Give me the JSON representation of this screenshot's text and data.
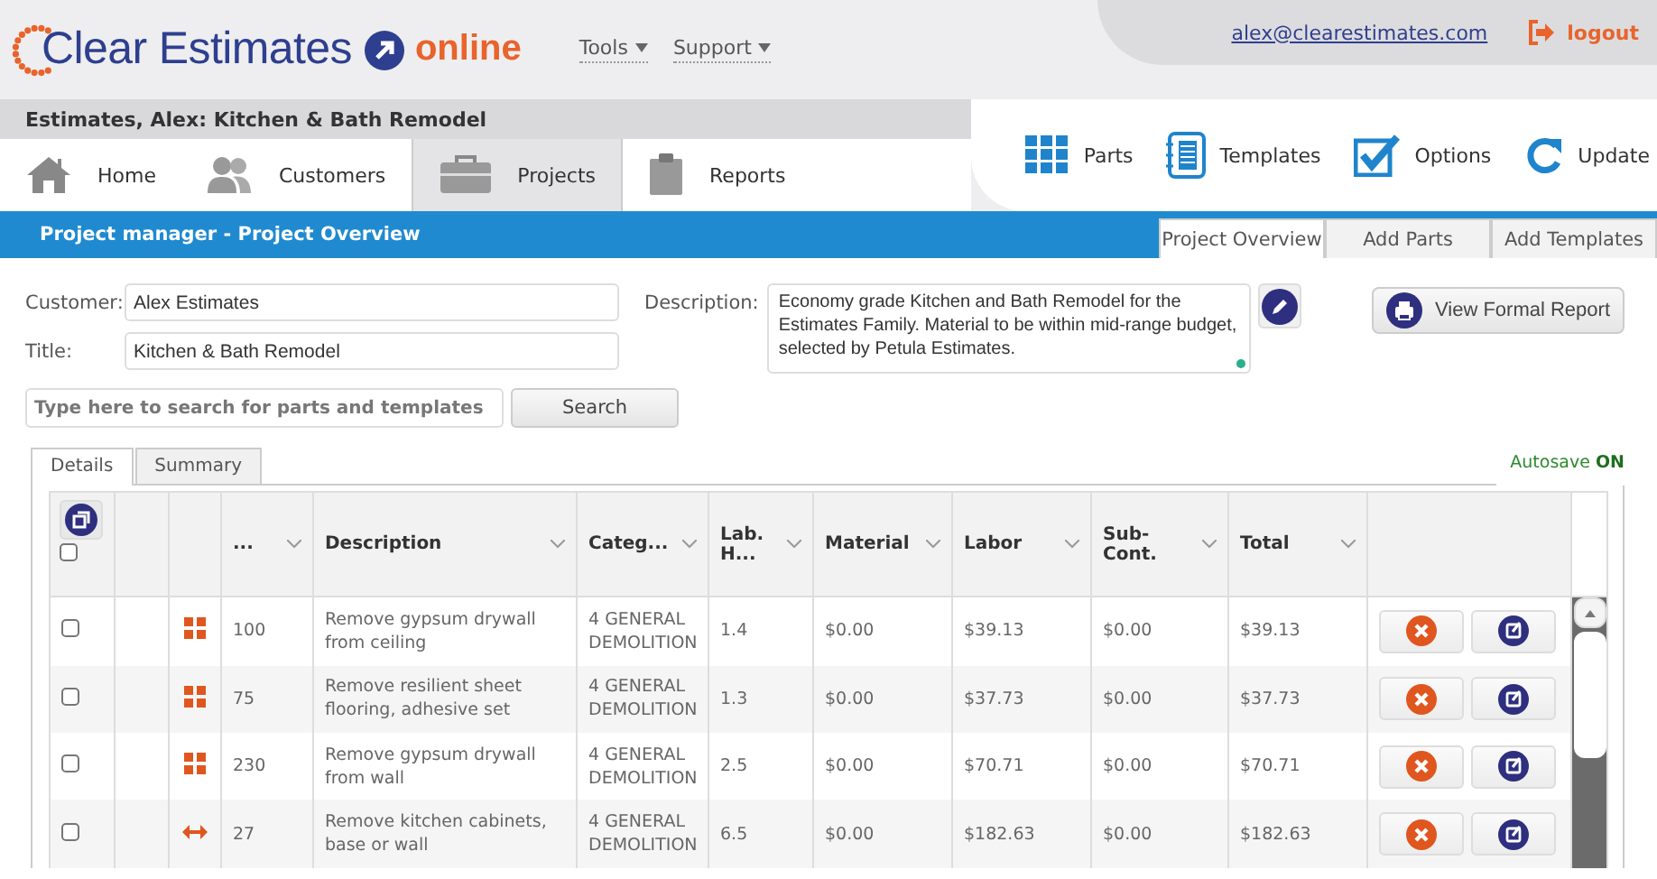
{
  "brand": {
    "name": "Clear Estimates",
    "suffix": "online"
  },
  "menus": [
    {
      "label": "Tools"
    },
    {
      "label": "Support"
    }
  ],
  "account": {
    "email": "alex@clearestimates.com",
    "logout": "logout"
  },
  "breadcrumb": "Estimates, Alex: Kitchen & Bath Remodel",
  "toolbar": [
    {
      "label": "Parts",
      "kind": "parts"
    },
    {
      "label": "Templates",
      "kind": "templates"
    },
    {
      "label": "Options",
      "kind": "options"
    },
    {
      "label": "Update",
      "kind": "update"
    }
  ],
  "nav": [
    {
      "label": "Home",
      "kind": "home",
      "selected": false
    },
    {
      "label": "Customers",
      "kind": "customers",
      "selected": false
    },
    {
      "label": "Projects",
      "kind": "projects",
      "selected": true
    },
    {
      "label": "Reports",
      "kind": "reports",
      "selected": false
    }
  ],
  "section": {
    "title": "Project manager - Project Overview",
    "tabs": [
      {
        "label": "Project Overview",
        "selected": true
      },
      {
        "label": "Add Parts",
        "selected": false
      },
      {
        "label": "Add Templates",
        "selected": false
      }
    ]
  },
  "form": {
    "customer": {
      "label": "Customer:",
      "value": "Alex Estimates"
    },
    "title": {
      "label": "Title:",
      "value": "Kitchen & Bath Remodel"
    },
    "description": {
      "label": "Description:",
      "value": "Economy grade Kitchen and Bath Remodel for the Estimates Family. Material to be within mid-range budget, selected by Petula Estimates."
    },
    "report_button": "View Formal Report",
    "search": {
      "placeholder": "Type here to search for parts and templates",
      "button": "Search"
    }
  },
  "detail_tabs": [
    {
      "label": "Details",
      "selected": true
    },
    {
      "label": "Summary",
      "selected": false
    }
  ],
  "autosave": {
    "label": "Autosave",
    "state": "ON"
  },
  "table": {
    "select_all": {
      "checked": false
    },
    "columns": [
      "...",
      "Description",
      "Categ...",
      "Lab. H...",
      "Material",
      "Labor",
      "Sub-Cont.",
      "Total"
    ],
    "rows": [
      {
        "kind": "grid",
        "checked": false,
        "number": "100",
        "description": "Remove gypsum drywall from ceiling",
        "category": "4 GENERAL DEMOLITION",
        "lab_hours": "1.4",
        "material": "$0.00",
        "labor": "$39.13",
        "subcont": "$0.00",
        "total": "$39.13"
      },
      {
        "kind": "grid",
        "checked": false,
        "number": "75",
        "description": "Remove resilient sheet flooring, adhesive set",
        "category": "4 GENERAL DEMOLITION",
        "lab_hours": "1.3",
        "material": "$0.00",
        "labor": "$37.73",
        "subcont": "$0.00",
        "total": "$37.73"
      },
      {
        "kind": "grid",
        "checked": false,
        "number": "230",
        "description": "Remove gypsum drywall from wall",
        "category": "4 GENERAL DEMOLITION",
        "lab_hours": "2.5",
        "material": "$0.00",
        "labor": "$70.71",
        "subcont": "$0.00",
        "total": "$70.71"
      },
      {
        "kind": "arrows",
        "checked": false,
        "number": "27",
        "description": "Remove kitchen cabinets, base or wall",
        "category": "4 GENERAL DEMOLITION",
        "lab_hours": "6.5",
        "material": "$0.00",
        "labor": "$182.63",
        "subcont": "$0.00",
        "total": "$182.63"
      }
    ]
  }
}
